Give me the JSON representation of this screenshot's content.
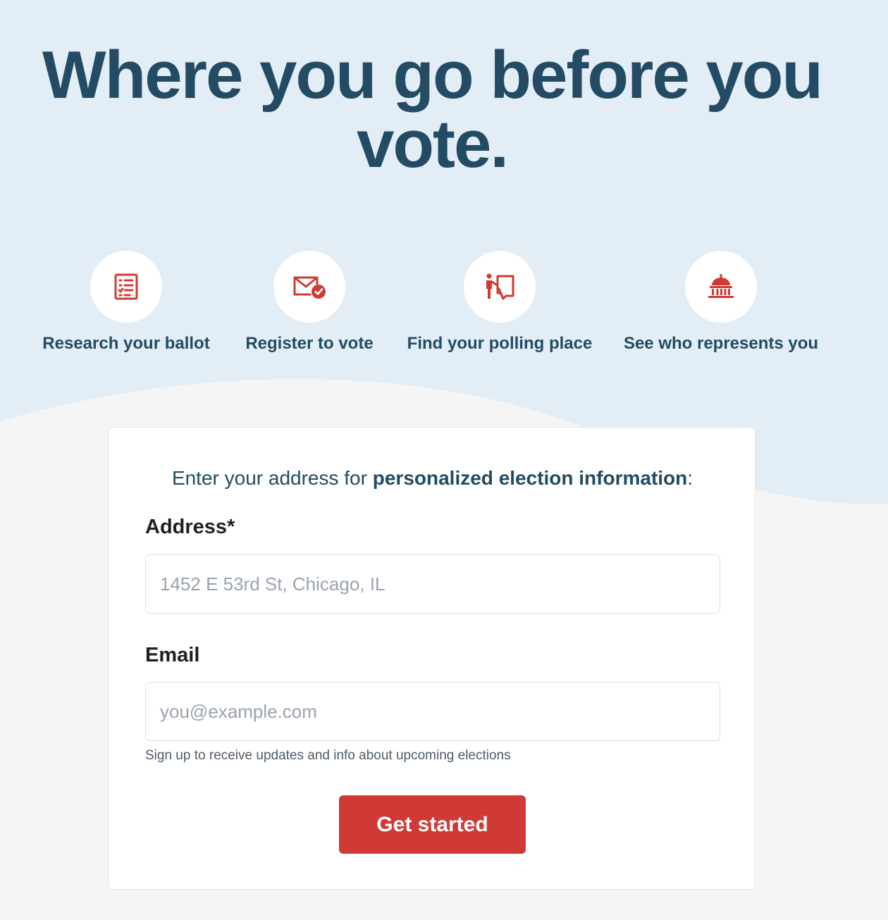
{
  "colors": {
    "hero_background": "#e2edf6",
    "page_background": "#f5f5f5",
    "headline": "#234b63",
    "icon_red": "#d03a35",
    "button_red": "#d03a35"
  },
  "hero": {
    "headline_line1": "Where you go before you",
    "headline_line2": "vote."
  },
  "features": [
    {
      "label": "Research your ballot",
      "icon": "ballot-checklist-icon"
    },
    {
      "label": "Register to vote",
      "icon": "envelope-check-icon"
    },
    {
      "label": "Find your polling place",
      "icon": "voting-booth-icon"
    },
    {
      "label": "See who represents you",
      "icon": "capitol-building-icon"
    }
  ],
  "form": {
    "intro_prefix": "Enter your address for ",
    "intro_bold": "personalized election information",
    "intro_suffix": ":",
    "address_label": "Address*",
    "address_placeholder": "1452 E 53rd St, Chicago, IL",
    "address_value": "",
    "email_label": "Email",
    "email_placeholder": "you@example.com",
    "email_value": "",
    "email_hint": "Sign up to receive updates and info about upcoming elections",
    "submit_label": "Get started"
  }
}
